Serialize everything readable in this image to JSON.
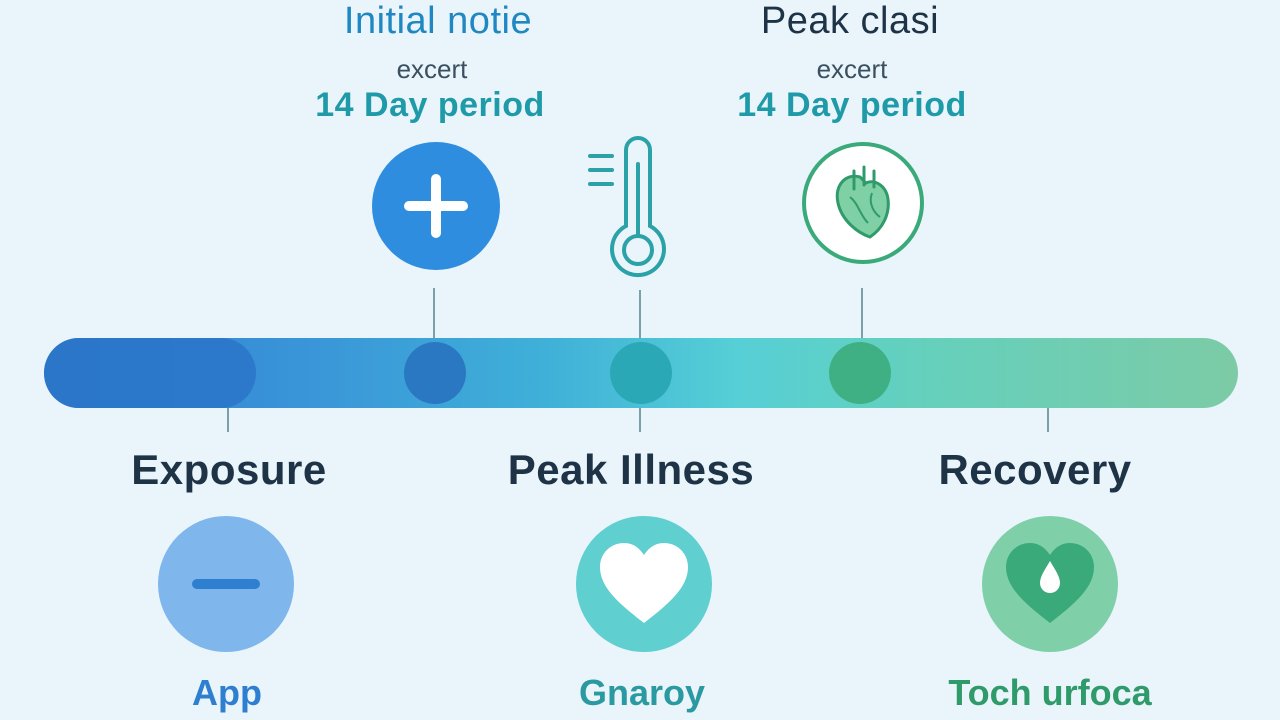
{
  "top_labels": [
    {
      "title": "Initial notie",
      "sub": "excert",
      "period": "14 Day period"
    },
    {
      "title": "Peak clasi",
      "sub": "excert",
      "period": "14 Day period"
    }
  ],
  "stages": [
    {
      "label": "Exposure",
      "sub": "App"
    },
    {
      "label": "Peak Illness",
      "sub": "Gnaroy"
    },
    {
      "label": "Recovery",
      "sub": "Toch urfoca"
    }
  ],
  "icons": {
    "top": [
      "plus-icon",
      "thermometer-icon",
      "heart-organ-icon"
    ],
    "bottom": [
      "minus-icon",
      "heart-icon",
      "heart-drop-icon"
    ]
  },
  "colors": {
    "blue": "#2f8de0",
    "teal": "#2aa2a8",
    "green": "#3aaa7a",
    "dark": "#1f3347",
    "background": "#e9f4fb"
  }
}
